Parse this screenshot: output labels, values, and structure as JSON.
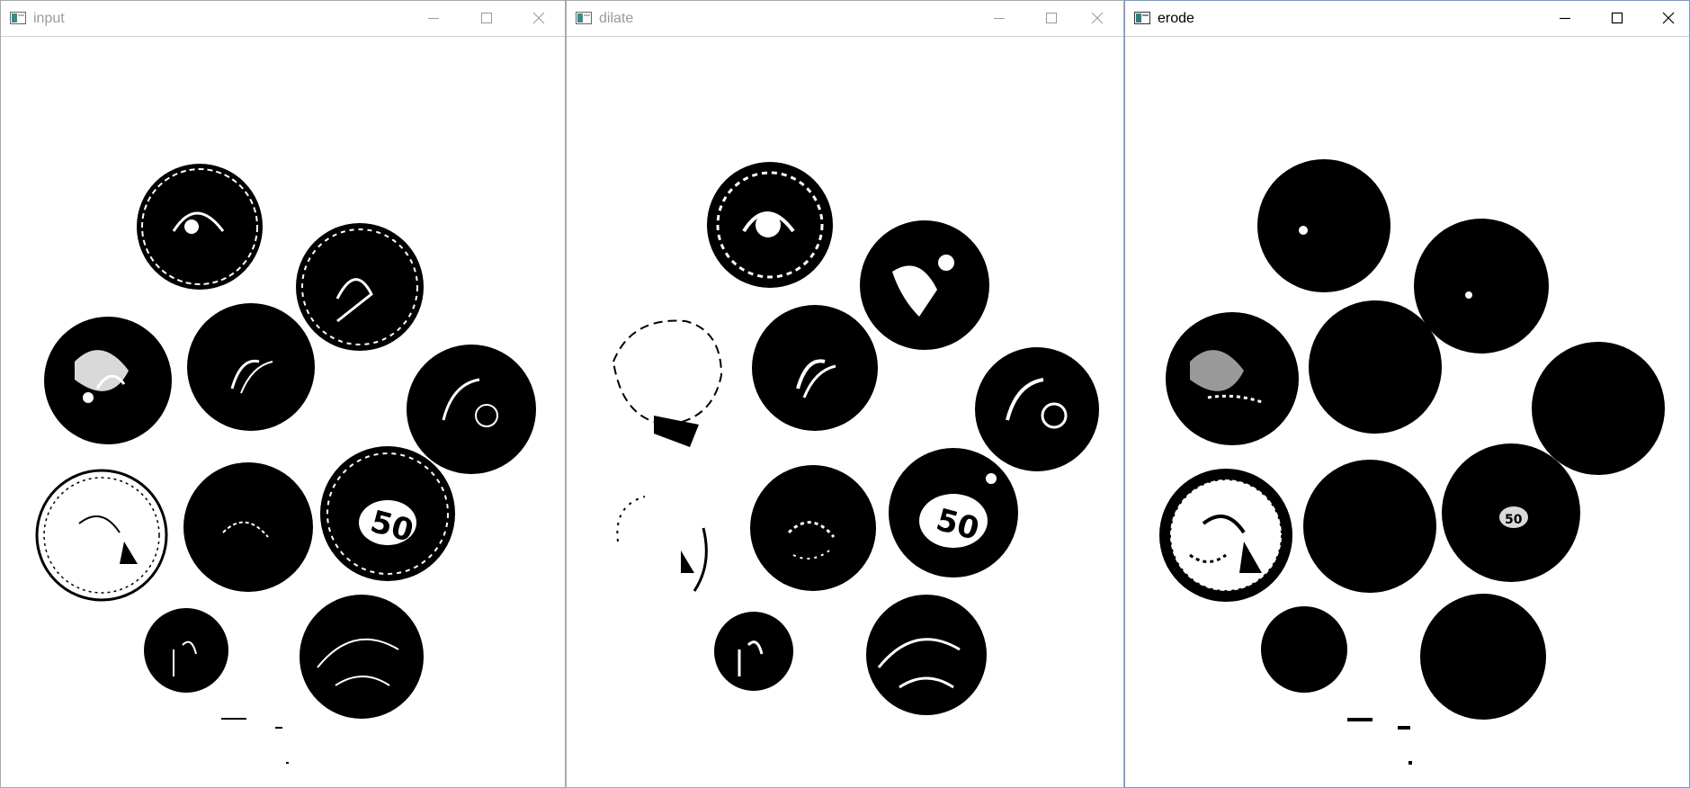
{
  "windows": [
    {
      "title": "input",
      "state": "inactive"
    },
    {
      "title": "dilate",
      "state": "inactive"
    },
    {
      "title": "erode",
      "state": "active"
    }
  ],
  "controls": {
    "minimize_icon": "minimize-icon",
    "maximize_icon": "maximize-icon",
    "close_icon": "close-icon"
  },
  "colors": {
    "ink": "#000000",
    "paper": "#ffffff",
    "inactive_title": "#9a9a9a",
    "active_border": "#6f9bd8"
  }
}
